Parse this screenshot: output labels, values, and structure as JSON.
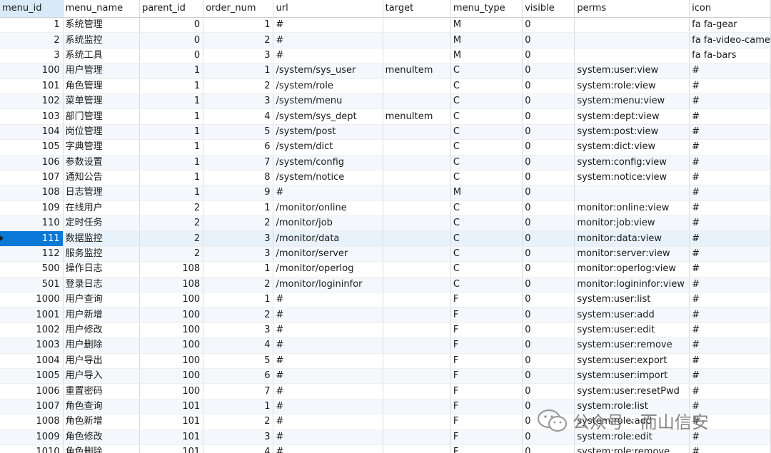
{
  "columns": [
    "menu_id",
    "menu_name",
    "parent_id",
    "order_num",
    "url",
    "target",
    "menu_type",
    "visible",
    "perms",
    "icon"
  ],
  "rows": [
    [
      "1",
      "系统管理",
      "0",
      "1",
      "#",
      "",
      "M",
      "0",
      "",
      "fa fa-gear"
    ],
    [
      "2",
      "系统监控",
      "0",
      "2",
      "#",
      "",
      "M",
      "0",
      "",
      "fa fa-video-came"
    ],
    [
      "3",
      "系统工具",
      "0",
      "3",
      "#",
      "",
      "M",
      "0",
      "",
      "fa fa-bars"
    ],
    [
      "100",
      "用户管理",
      "1",
      "1",
      "/system/sys_user",
      "menuItem",
      "C",
      "0",
      "system:user:view",
      "#"
    ],
    [
      "101",
      "角色管理",
      "1",
      "2",
      "/system/role",
      "",
      "C",
      "0",
      "system:role:view",
      "#"
    ],
    [
      "102",
      "菜单管理",
      "1",
      "3",
      "/system/menu",
      "",
      "C",
      "0",
      "system:menu:view",
      "#"
    ],
    [
      "103",
      "部门管理",
      "1",
      "4",
      "/system/sys_dept",
      "menuItem",
      "C",
      "0",
      "system:dept:view",
      "#"
    ],
    [
      "104",
      "岗位管理",
      "1",
      "5",
      "/system/post",
      "",
      "C",
      "0",
      "system:post:view",
      "#"
    ],
    [
      "105",
      "字典管理",
      "1",
      "6",
      "/system/dict",
      "",
      "C",
      "0",
      "system:dict:view",
      "#"
    ],
    [
      "106",
      "参数设置",
      "1",
      "7",
      "/system/config",
      "",
      "C",
      "0",
      "system:config:view",
      "#"
    ],
    [
      "107",
      "通知公告",
      "1",
      "8",
      "/system/notice",
      "",
      "C",
      "0",
      "system:notice:view",
      "#"
    ],
    [
      "108",
      "日志管理",
      "1",
      "9",
      "#",
      "",
      "M",
      "0",
      "",
      "#"
    ],
    [
      "109",
      "在线用户",
      "2",
      "1",
      "/monitor/online",
      "",
      "C",
      "0",
      "monitor:online:view",
      "#"
    ],
    [
      "110",
      "定时任务",
      "2",
      "2",
      "/monitor/job",
      "",
      "C",
      "0",
      "monitor:job:view",
      "#"
    ],
    [
      "111",
      "数据监控",
      "2",
      "3",
      "/monitor/data",
      "",
      "C",
      "0",
      "monitor:data:view",
      "#"
    ],
    [
      "112",
      "服务监控",
      "2",
      "3",
      "/monitor/server",
      "",
      "C",
      "0",
      "monitor:server:view",
      "#"
    ],
    [
      "500",
      "操作日志",
      "108",
      "1",
      "/monitor/operlog",
      "",
      "C",
      "0",
      "monitor:operlog:view",
      "#"
    ],
    [
      "501",
      "登录日志",
      "108",
      "2",
      "/monitor/logininfor",
      "",
      "C",
      "0",
      "monitor:logininfor:view",
      "#"
    ],
    [
      "1000",
      "用户查询",
      "100",
      "1",
      "#",
      "",
      "F",
      "0",
      "system:user:list",
      "#"
    ],
    [
      "1001",
      "用户新增",
      "100",
      "2",
      "#",
      "",
      "F",
      "0",
      "system:user:add",
      "#"
    ],
    [
      "1002",
      "用户修改",
      "100",
      "3",
      "#",
      "",
      "F",
      "0",
      "system:user:edit",
      "#"
    ],
    [
      "1003",
      "用户删除",
      "100",
      "4",
      "#",
      "",
      "F",
      "0",
      "system:user:remove",
      "#"
    ],
    [
      "1004",
      "用户导出",
      "100",
      "5",
      "#",
      "",
      "F",
      "0",
      "system:user:export",
      "#"
    ],
    [
      "1005",
      "用户导入",
      "100",
      "6",
      "#",
      "",
      "F",
      "0",
      "system:user:import",
      "#"
    ],
    [
      "1006",
      "重置密码",
      "100",
      "7",
      "#",
      "",
      "F",
      "0",
      "system:user:resetPwd",
      "#"
    ],
    [
      "1007",
      "角色查询",
      "101",
      "1",
      "#",
      "",
      "F",
      "0",
      "system:role:list",
      "#"
    ],
    [
      "1008",
      "角色新增",
      "101",
      "2",
      "#",
      "",
      "F",
      "0",
      "system:role:add",
      "#"
    ],
    [
      "1009",
      "角色修改",
      "101",
      "3",
      "#",
      "",
      "F",
      "0",
      "system:role:edit",
      "#"
    ],
    [
      "1010",
      "角色删除",
      "101",
      "4",
      "#",
      "",
      "F",
      "0",
      "system:role:remove",
      "#"
    ]
  ],
  "selected_row": 14,
  "watermark": {
    "text": "公众号 · 而山信安",
    "icon": "wechat-logo-icon"
  },
  "colors": {
    "header_sorted": "#d9ebf9",
    "selection": "#0a78d7",
    "stripe": "#f4f8fc",
    "grid_line": "#dcdcdc"
  }
}
